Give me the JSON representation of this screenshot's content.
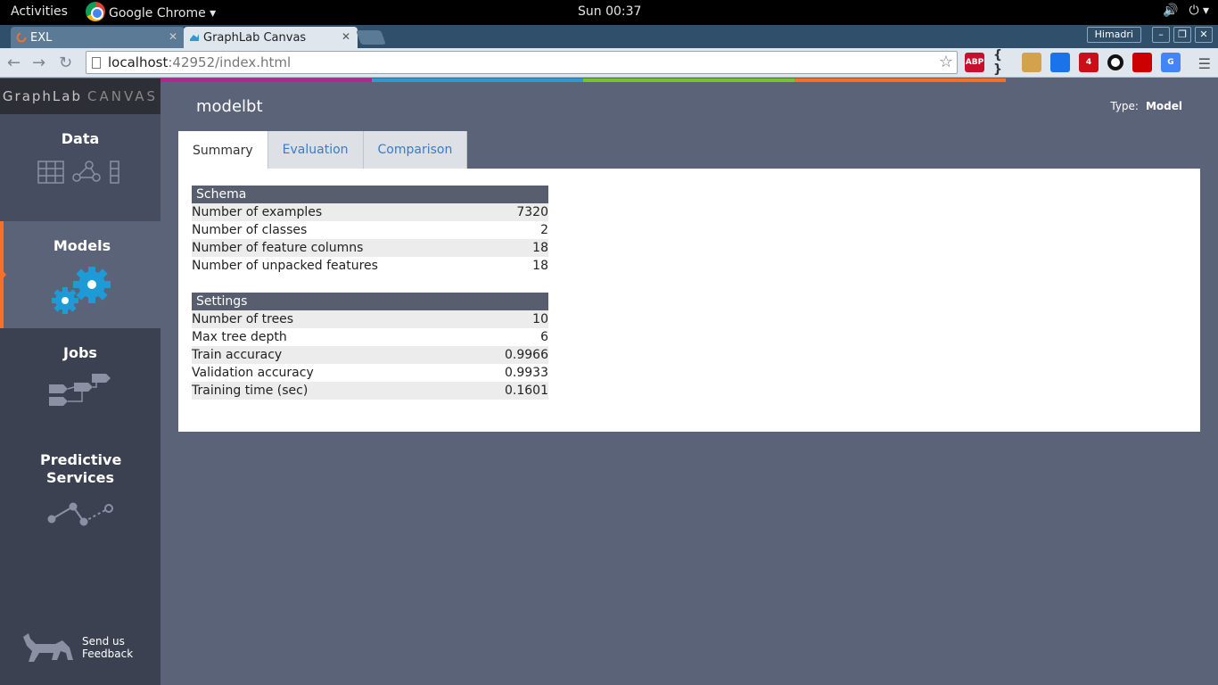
{
  "os": {
    "activities": "Activities",
    "app_menu": "Google Chrome ▾",
    "clock": "Sun 00:37"
  },
  "browser": {
    "tabs": [
      {
        "title": "EXL"
      },
      {
        "title": "GraphLab Canvas"
      }
    ],
    "user": "Himadri",
    "url_host": "localhost",
    "url_rest": ":42952/index.html",
    "extensions": [
      {
        "name": "adblock-plus-icon",
        "text": "ABP",
        "color": "#c8102e"
      },
      {
        "name": "json-formatter-icon",
        "text": "{ }",
        "color": "#333333"
      },
      {
        "name": "ext-face-icon",
        "text": "",
        "color": "#d4a24c"
      },
      {
        "name": "pocket-icon",
        "text": "",
        "color": "#1a73e8"
      },
      {
        "name": "opera-icon",
        "text": "4",
        "color": "#cc0f16"
      },
      {
        "name": "circle-icon",
        "text": "",
        "color": "#111111"
      },
      {
        "name": "medical-cross-icon",
        "text": "",
        "color": "#cc0000"
      },
      {
        "name": "google-translate-icon",
        "text": "G",
        "color": "#4285f4"
      }
    ]
  },
  "app": {
    "brand_main": "GraphLab",
    "brand_sub": "CANVAS",
    "nav": [
      {
        "label": "Data"
      },
      {
        "label": "Models"
      },
      {
        "label": "Jobs"
      },
      {
        "label": "Predictive Services"
      }
    ],
    "feedback_line1": "Send us",
    "feedback_line2": "Feedback"
  },
  "main": {
    "model_name": "modelbt",
    "type_label": "Type:",
    "type_value": "Model",
    "tabs": [
      {
        "label": "Summary"
      },
      {
        "label": "Evaluation"
      },
      {
        "label": "Comparison"
      }
    ],
    "schema": {
      "title": "Schema",
      "rows": [
        {
          "label": "Number of examples",
          "value": "7320"
        },
        {
          "label": "Number of classes",
          "value": "2"
        },
        {
          "label": "Number of feature columns",
          "value": "18"
        },
        {
          "label": "Number of unpacked features",
          "value": "18"
        }
      ]
    },
    "settings": {
      "title": "Settings",
      "rows": [
        {
          "label": "Number of trees",
          "value": "10"
        },
        {
          "label": "Max tree depth",
          "value": "6"
        },
        {
          "label": "Train accuracy",
          "value": "0.9966"
        },
        {
          "label": "Validation accuracy",
          "value": "0.9933"
        },
        {
          "label": "Training time (sec)",
          "value": "0.1601"
        }
      ]
    }
  },
  "colors": {
    "accent": "#f5712a",
    "stripe": [
      "#b0288e",
      "#2d9ad6",
      "#7cc133",
      "#f5712a"
    ]
  }
}
